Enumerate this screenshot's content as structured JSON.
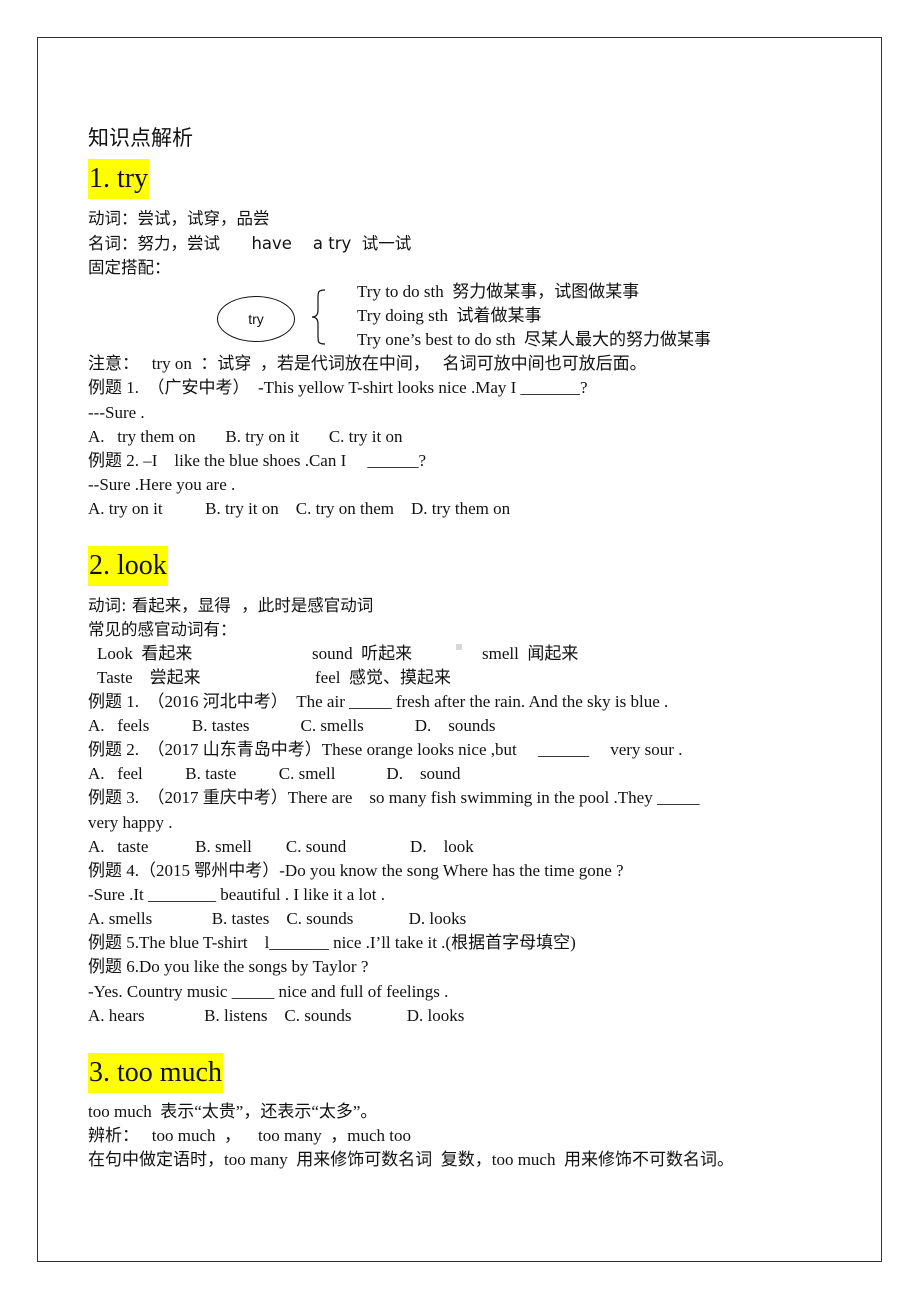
{
  "document": {
    "title": "知识点解析",
    "sections": [
      {
        "heading": "1. try",
        "lines": {
          "verb": "动词：尝试，试穿，品尝",
          "noun": "名词：努力，尝试      have    a try  试一试",
          "collocation_label": "固定搭配："
        },
        "diagram": {
          "oval_label": "try",
          "items": [
            "Try to do sth  努力做某事，试图做某事",
            "Try doing sth  试着做某事",
            "Try one’s best to do sth  尽某人最大的努力做某事"
          ]
        },
        "note": "注意：   try on  ：试穿  ，若是代词放在中间，   名词可放中间也可放后面。",
        "examples": [
          {
            "question": "例题 1.  （广安中考）  -This yellow T-shirt looks nice .May I _______?",
            "reply": "---Sure .",
            "options": "A.   try them on       B. try on it       C. try it on"
          },
          {
            "question": "例题 2. –I    like the blue shoes .Can I     ______?",
            "reply": "--Sure .Here you are .",
            "options": "A. try on it          B. try it on    C. try on them    D. try them on"
          }
        ]
      },
      {
        "heading": "2. look",
        "lines": {
          "verb": "动词: 看起来，显得  ，此时是感官动词",
          "common": "常见的感官动词有："
        },
        "sense_verbs": [
          {
            "text": "Look  看起来",
            "row": 0,
            "col": 0
          },
          {
            "text": "sound  听起来",
            "row": 0,
            "col": 1
          },
          {
            "text": "smell  闻起来",
            "row": 0,
            "col": 2
          },
          {
            "text": "Taste    尝起来",
            "row": 1,
            "col": 0
          },
          {
            "text": "feel  感觉、摸起来",
            "row": 1,
            "col": 1
          }
        ],
        "examples": [
          "例题 1.  （2016 河北中考）  The air _____ fresh after the rain. And the sky is blue .",
          "A.   feels          B. tastes            C. smells            D.    sounds",
          "例题 2.  （2017 山东青岛中考）These orange looks nice ,but     ______     very sour .",
          "A.   feel          B. taste          C. smell            D.    sound",
          "例题 3.  （2017 重庆中考）There are    so many fish swimming in the pool .They _____",
          "very happy .",
          "A.   taste           B. smell        C. sound               D.    look",
          "例题 4.（2015 鄂州中考）-Do you know the song Where has the time gone ?",
          "-Sure .It ________ beautiful . I like it a lot .",
          "A. smells              B. tastes    C. sounds             D. looks",
          "例题 5.The blue T-shirt    l_______ nice .I’ll take it .(根据首字母填空)",
          "例题 6.Do you like the songs by Taylor ?",
          "-Yes. Country music _____ nice and full of feelings .",
          "A. hears              B. listens    C. sounds             D. looks"
        ]
      },
      {
        "heading": "3. too much",
        "lines": [
          "too much  表示“太贵”，还表示“太多”。",
          "辨析：   too much  ，    too many  ，much too",
          "在句中做定语时，too many  用来修饰可数名词  复数，too much  用来修饰不可数名词。"
        ]
      }
    ]
  }
}
